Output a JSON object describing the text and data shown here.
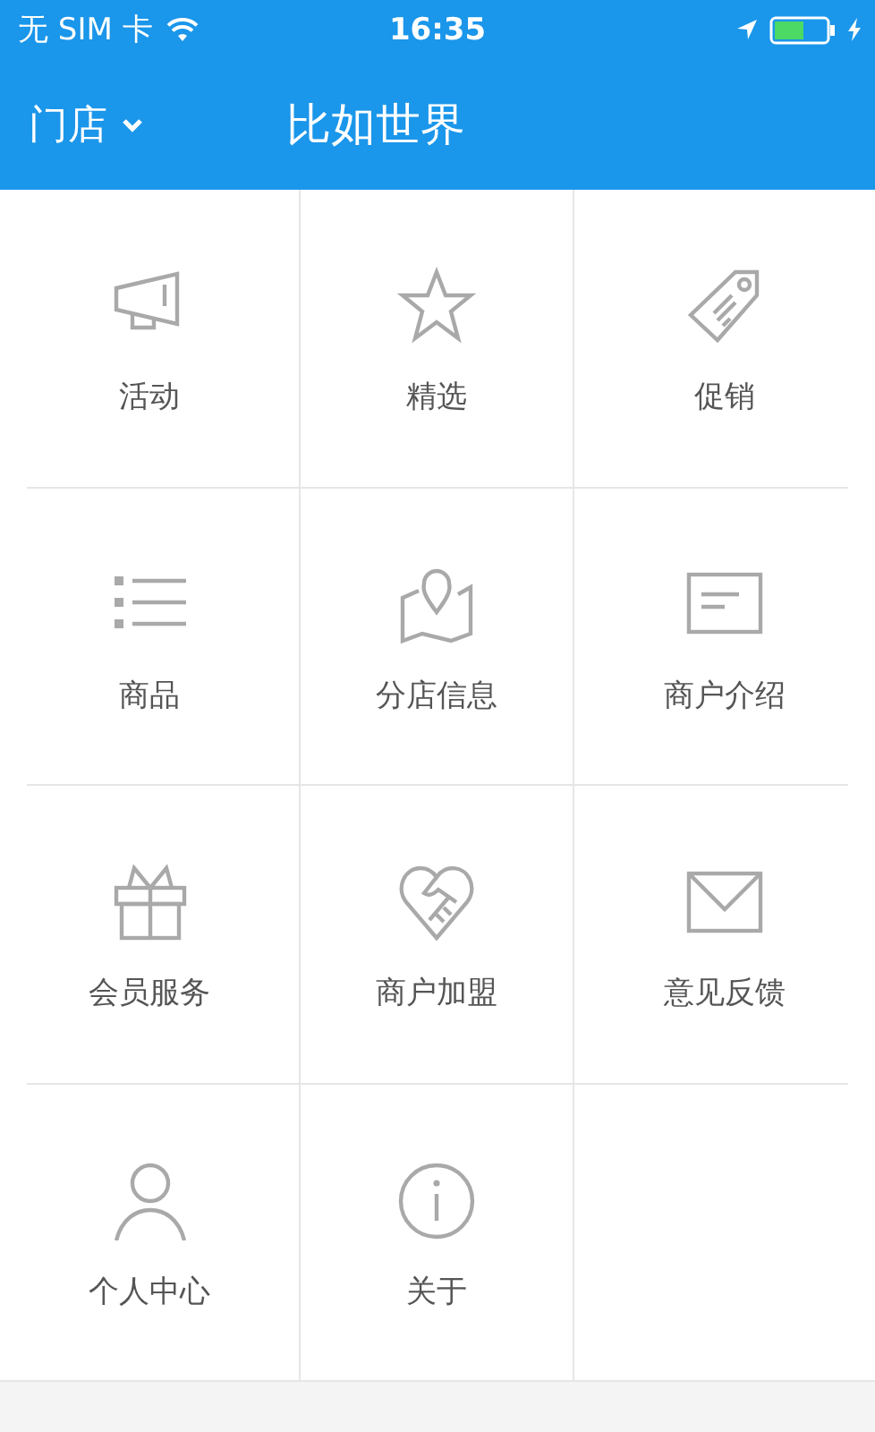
{
  "status_bar": {
    "carrier": "无 SIM 卡",
    "time": "16:35"
  },
  "nav_bar": {
    "store_menu": "门店",
    "title": "比如世界"
  },
  "menu": [
    {
      "label": "活动",
      "kind": "megaphone"
    },
    {
      "label": "精选",
      "kind": "star"
    },
    {
      "label": "促销",
      "kind": "tag"
    },
    {
      "label": "商品",
      "kind": "list"
    },
    {
      "label": "分店信息",
      "kind": "map"
    },
    {
      "label": "商户介绍",
      "kind": "card"
    },
    {
      "label": "会员服务",
      "kind": "gift"
    },
    {
      "label": "商户加盟",
      "kind": "handshake"
    },
    {
      "label": "意见反馈",
      "kind": "envelope"
    },
    {
      "label": "个人中心",
      "kind": "person"
    },
    {
      "label": "关于",
      "kind": "info"
    }
  ]
}
